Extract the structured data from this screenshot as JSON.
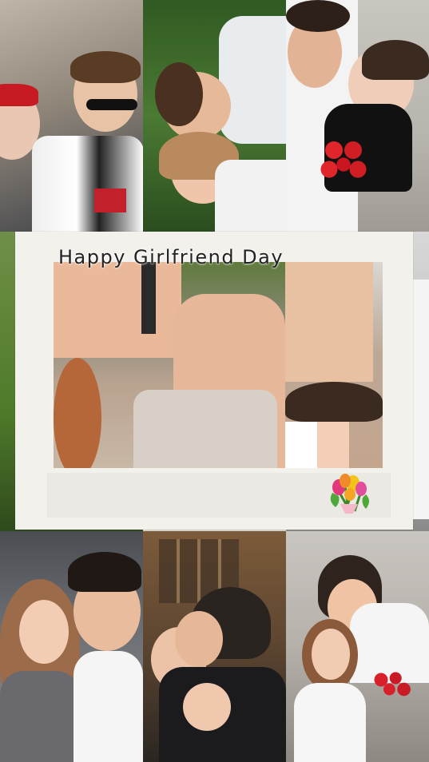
{
  "caption": {
    "text": "Happy Girlfriend Day"
  },
  "icons": {
    "bouquet": "tulip-bouquet-icon"
  },
  "colors": {
    "card": "#f3f1ec",
    "caption_text": "#222222"
  }
}
